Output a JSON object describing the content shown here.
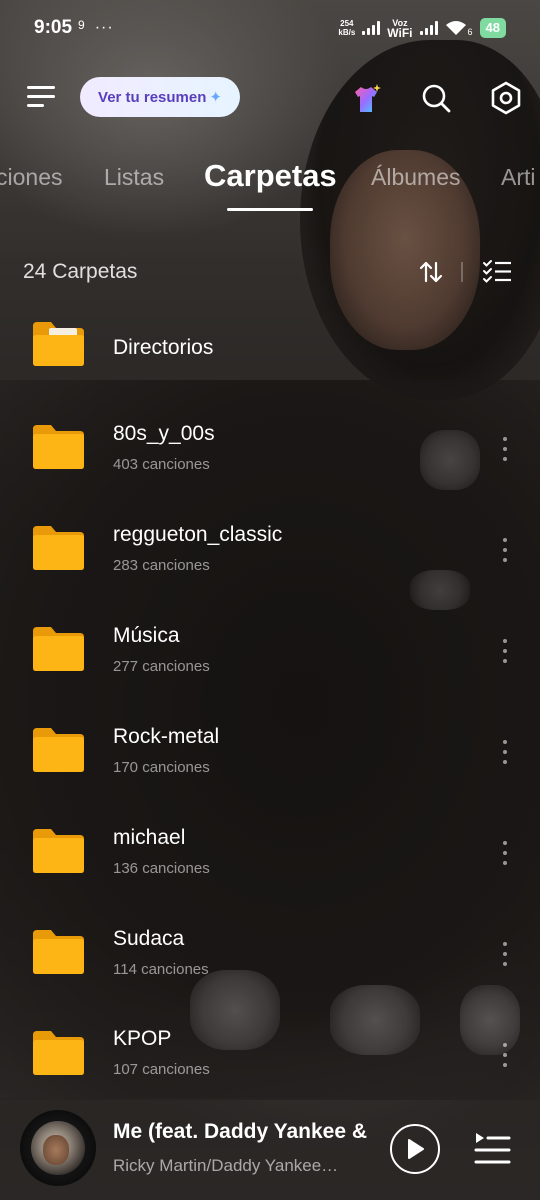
{
  "status_bar": {
    "time": "9:05",
    "notif": "9",
    "more": "···",
    "speed_value": "254",
    "speed_unit": "kB/s",
    "voz": "Voz",
    "wifi": "WiFi",
    "wifi_extra": "6",
    "battery": "48"
  },
  "header": {
    "summary_label": "Ver tu resumen",
    "icons": [
      "menu-icon",
      "theme-icon",
      "search-icon",
      "settings-icon"
    ]
  },
  "tabs": [
    {
      "label": "ciones",
      "active": false
    },
    {
      "label": "Listas",
      "active": false
    },
    {
      "label": "Carpetas",
      "active": true
    },
    {
      "label": "Álbumes",
      "active": false
    },
    {
      "label": "Arti",
      "active": false
    }
  ],
  "list_header": {
    "count_label": "24 Carpetas"
  },
  "folders": [
    {
      "name": "Directorios",
      "subtitle": "",
      "kind": "directory"
    },
    {
      "name": "80s_y_00s",
      "subtitle": "403 canciones"
    },
    {
      "name": "reggueton_classic",
      "subtitle": "283 canciones"
    },
    {
      "name": "Música",
      "subtitle": "277 canciones"
    },
    {
      "name": "Rock-metal",
      "subtitle": "170 canciones"
    },
    {
      "name": "michael",
      "subtitle": "136 canciones"
    },
    {
      "name": "Sudaca",
      "subtitle": "114 canciones"
    },
    {
      "name": "KPOP",
      "subtitle": "107 canciones"
    }
  ],
  "player": {
    "title": "Me (feat. Daddy Yankee &",
    "artist": "Ricky Martin/Daddy Yankee…"
  },
  "colors": {
    "folder": "#fdb515",
    "folder_tab": "#e99a08",
    "summary_text": "#5a3fbd",
    "battery": "#7fdba0"
  }
}
